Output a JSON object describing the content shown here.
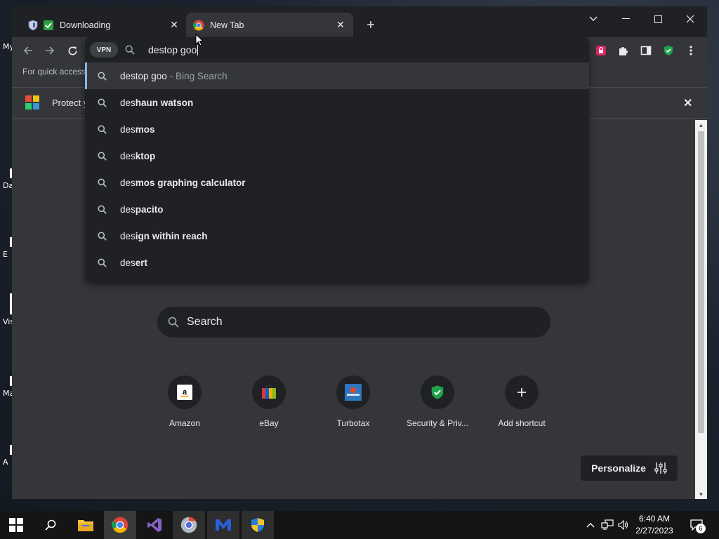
{
  "desktop": {
    "icons": [
      {
        "label": "My"
      },
      {
        "label": "Da"
      },
      {
        "label": "E"
      },
      {
        "label": "Vis"
      },
      {
        "label": "Ma"
      },
      {
        "label": "A"
      }
    ]
  },
  "browser": {
    "tabs": [
      {
        "title": "Downloading",
        "active": false
      },
      {
        "title": "New Tab",
        "active": true
      }
    ],
    "bookmarks_bar_text": "For quick access,",
    "infobar_text": "Protect y",
    "omnibox": {
      "vpn_label": "VPN",
      "input_value": "destop goo",
      "suggestions": [
        {
          "bold": "destop goo",
          "normal_prefix": "",
          "suffix": "- Bing Search",
          "selected": true
        },
        {
          "normal_prefix": "des",
          "bold": "haun watson"
        },
        {
          "normal_prefix": "des",
          "bold": "mos"
        },
        {
          "normal_prefix": "des",
          "bold": "ktop"
        },
        {
          "normal_prefix": "des",
          "bold": "mos graphing calculator"
        },
        {
          "normal_prefix": "des",
          "bold": "pacito"
        },
        {
          "normal_prefix": "des",
          "bold": "ign within reach"
        },
        {
          "normal_prefix": "des",
          "bold": "ert"
        }
      ]
    },
    "ntp": {
      "search_placeholder": "Search",
      "shortcuts": [
        {
          "label": "Amazon",
          "icon": "amazon-icon"
        },
        {
          "label": "eBay",
          "icon": "ebay-icon"
        },
        {
          "label": "Turbotax",
          "icon": "turbotax-icon"
        },
        {
          "label": "Security & Priv...",
          "icon": "shield-check-icon"
        },
        {
          "label": "Add shortcut",
          "icon": "plus-icon"
        }
      ],
      "personalize_label": "Personalize"
    }
  },
  "taskbar": {
    "time": "6:40 AM",
    "date": "2/27/2023",
    "notification_count": "6"
  },
  "colors": {
    "accent": "#8ab4f8",
    "chrome_dark": "#202124",
    "chrome_mid": "#35363a"
  }
}
